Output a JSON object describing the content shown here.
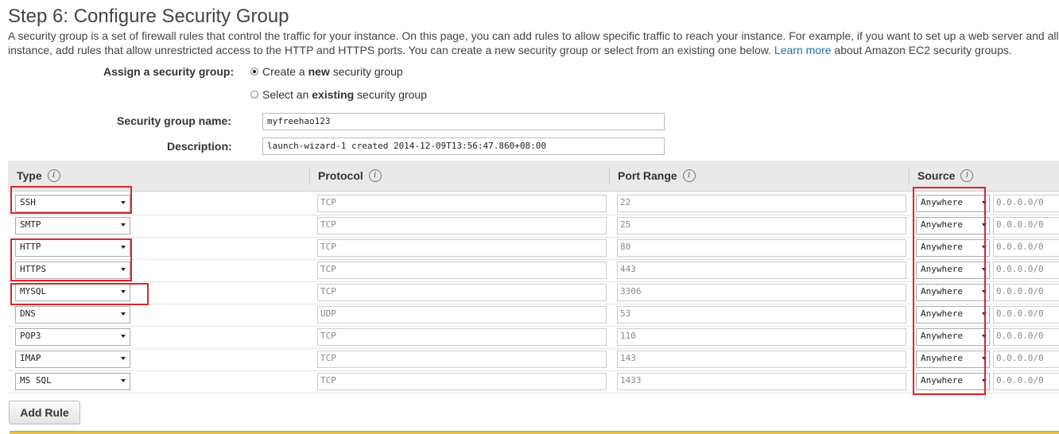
{
  "page": {
    "title": "Step 6: Configure Security Group",
    "intro_line1": "A security group is a set of firewall rules that control the traffic for your instance. On this page, you can add rules to allow specific traffic to reach your instance. For example, if you want to set up a web server and allow Internet traffic to reach your",
    "intro_line2_pre": "instance, add rules that allow unrestricted access to the HTTP and HTTPS ports. You can create a new security group or select from an existing one below.",
    "intro_link": "Learn more",
    "intro_line2_post": "about Amazon EC2 security groups."
  },
  "assign": {
    "label": "Assign a security group:",
    "option_new_pre": "Create a ",
    "option_new_bold": "new",
    "option_new_post": " security group",
    "option_existing_pre": "Select an ",
    "option_existing_bold": "existing",
    "option_existing_post": " security group",
    "selected": "new"
  },
  "form": {
    "name_label": "Security group name:",
    "name_value": "myfreehao123",
    "desc_label": "Description:",
    "desc_value": "launch-wizard-1 created 2014-12-09T13:56:47.860+08:00"
  },
  "table": {
    "headers": {
      "type": "Type",
      "protocol": "Protocol",
      "port": "Port Range",
      "source": "Source"
    },
    "info_glyph": "i",
    "rows": [
      {
        "type": "SSH",
        "protocol": "TCP",
        "port": "22",
        "source": "Anywhere",
        "cidr": "0.0.0.0/0"
      },
      {
        "type": "SMTP",
        "protocol": "TCP",
        "port": "25",
        "source": "Anywhere",
        "cidr": "0.0.0.0/0"
      },
      {
        "type": "HTTP",
        "protocol": "TCP",
        "port": "80",
        "source": "Anywhere",
        "cidr": "0.0.0.0/0"
      },
      {
        "type": "HTTPS",
        "protocol": "TCP",
        "port": "443",
        "source": "Anywhere",
        "cidr": "0.0.0.0/0"
      },
      {
        "type": "MYSQL",
        "protocol": "TCP",
        "port": "3306",
        "source": "Anywhere",
        "cidr": "0.0.0.0/0"
      },
      {
        "type": "DNS",
        "protocol": "UDP",
        "port": "53",
        "source": "Anywhere",
        "cidr": "0.0.0.0/0"
      },
      {
        "type": "POP3",
        "protocol": "TCP",
        "port": "110",
        "source": "Anywhere",
        "cidr": "0.0.0.0/0"
      },
      {
        "type": "IMAP",
        "protocol": "TCP",
        "port": "143",
        "source": "Anywhere",
        "cidr": "0.0.0.0/0"
      },
      {
        "type": "MS SQL",
        "protocol": "TCP",
        "port": "1433",
        "source": "Anywhere",
        "cidr": "0.0.0.0/0"
      }
    ]
  },
  "actions": {
    "add_rule": "Add Rule"
  },
  "colors": {
    "highlight": "#d8252f",
    "link": "#1a6fb5",
    "header_bg": "#e9e9e9"
  }
}
